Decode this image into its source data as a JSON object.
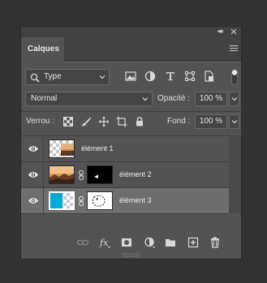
{
  "panel": {
    "tab_label": "Calques"
  },
  "filter": {
    "kind_label": "Type"
  },
  "blend": {
    "mode": "Normal",
    "opacity_label": "Opacité :",
    "opacity_value": "100 %",
    "lock_label": "Verrou :",
    "fill_label": "Fond :",
    "fill_value": "100 %"
  },
  "layers": [
    {
      "name": "élément 1",
      "visible": true,
      "selected": false,
      "has_mask": false
    },
    {
      "name": "élément 2",
      "visible": true,
      "selected": false,
      "has_mask": true
    },
    {
      "name": "élément 3",
      "visible": true,
      "selected": true,
      "has_mask": true
    }
  ],
  "icons": {
    "filter": [
      "search-icon",
      "image-filter-icon",
      "adjustment-filter-icon",
      "type-filter-icon",
      "shape-filter-icon",
      "smart-object-filter-icon"
    ],
    "lock": [
      "lock-transparent-pixels-icon",
      "lock-image-pixels-icon",
      "lock-position-icon",
      "lock-artboard-icon",
      "lock-all-icon"
    ],
    "bottom": [
      "link-layers-icon",
      "fx-icon",
      "add-mask-icon",
      "new-adjustment-icon",
      "new-group-icon",
      "new-layer-icon",
      "delete-icon"
    ]
  },
  "colors": {
    "panel_bg": "#535353",
    "selected_row": "#6e6e6e",
    "layer3_color": "#00aadd"
  }
}
